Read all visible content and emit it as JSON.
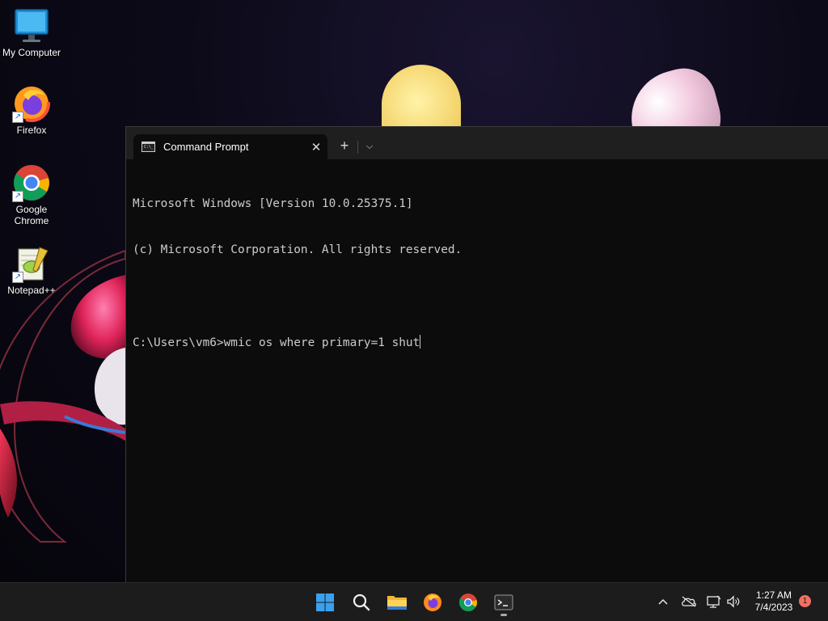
{
  "desktop": {
    "icons": [
      {
        "label_line1": "My Computer",
        "label_line2": "",
        "icon": "monitor-icon"
      },
      {
        "label_line1": "Firefox",
        "label_line2": "",
        "icon": "firefox-icon"
      },
      {
        "label_line1": "Google",
        "label_line2": "Chrome",
        "icon": "chrome-icon"
      },
      {
        "label_line1": "Notepad++",
        "label_line2": "",
        "icon": "notepadpp-icon"
      }
    ]
  },
  "terminal": {
    "tab_title": "Command Prompt",
    "close_glyph": "✕",
    "new_tab_glyph": "+",
    "dropdown_glyph": "⌵",
    "lines": [
      "Microsoft Windows [Version 10.0.25375.1]",
      "(c) Microsoft Corporation. All rights reserved.",
      "",
      "C:\\Users\\vm6>wmic os where primary=1 shut"
    ]
  },
  "taskbar": {
    "apps": [
      "start-icon",
      "search-icon",
      "file-explorer-icon",
      "firefox-icon",
      "chrome-icon",
      "terminal-icon"
    ],
    "active_app": "terminal-icon",
    "tray": {
      "chevron_glyph": "^",
      "time": "1:27 AM",
      "date": "7/4/2023",
      "notification_count": "1"
    }
  },
  "colors": {
    "taskbar_bg": "#1c1c1c",
    "terminal_bg": "#0c0c0c",
    "tabbar_bg": "#1f1f1f",
    "console_text": "#cccccc",
    "notification_badge": "#f46f60"
  }
}
